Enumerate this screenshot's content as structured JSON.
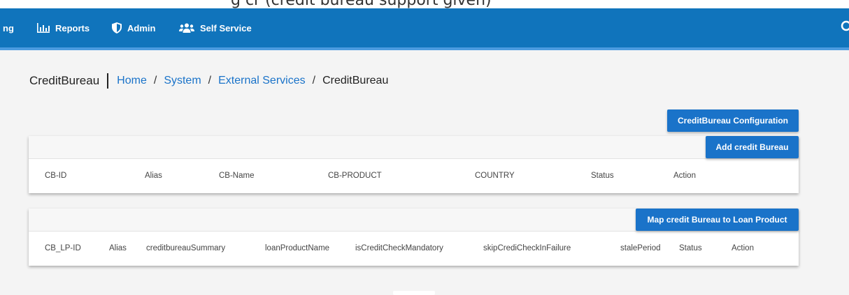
{
  "top_strip": {
    "text": "g cr (credit bureau support given) "
  },
  "nav": {
    "cut_item": "ng",
    "items": [
      {
        "label": "Reports",
        "icon": "bar-chart-icon"
      },
      {
        "label": "Admin",
        "icon": "shield-icon"
      },
      {
        "label": "Self Service",
        "icon": "users-icon"
      }
    ],
    "search_icon": "search-icon"
  },
  "page": {
    "title": "CreditBureau",
    "breadcrumb": [
      "Home",
      "System",
      "External Services"
    ],
    "breadcrumb_current": "CreditBureau",
    "separator": "/"
  },
  "buttons": {
    "config": "CreditBureau Configuration",
    "add": "Add credit Bureau",
    "map": "Map credit Bureau to Loan Product"
  },
  "table1": {
    "columns": [
      "CB-ID",
      "Alias",
      "CB-Name",
      "CB-PRODUCT",
      "COUNTRY",
      "Status",
      "Action"
    ]
  },
  "table2": {
    "columns": [
      "CB_LP-ID",
      "Alias",
      "creditbureauSummary",
      "loanProductName",
      "isCreditCheckMandatory",
      "skipCrediCheckInFailure",
      "stalePeriod",
      "Status",
      "Action"
    ]
  },
  "colors": {
    "navbar": "#1074bc",
    "accent": "#1a73c9",
    "nav_border": "#4b9be0"
  }
}
